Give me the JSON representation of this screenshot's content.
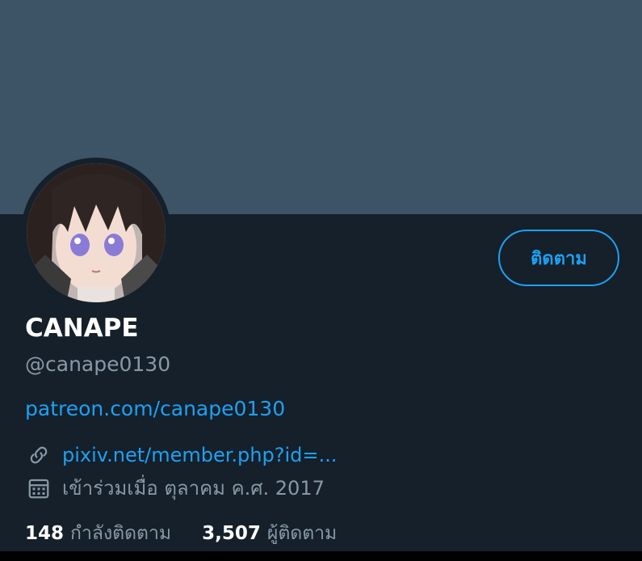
{
  "profile": {
    "display_name": "CANAPE",
    "handle": "@canape0130",
    "bio_link": "patreon.com/canape0130",
    "website": "pixiv.net/member.php?id=...",
    "joined": "เข้าร่วมเมื่อ ตุลาคม ค.ศ. 2017"
  },
  "actions": {
    "follow_label": "ติดตาม"
  },
  "stats": {
    "following_count": "148",
    "following_label": "กำลังติดตาม",
    "followers_count": "3,507",
    "followers_label": "ผู้ติดตาม"
  },
  "icons": {
    "link": "link-icon",
    "calendar": "calendar-icon"
  },
  "colors": {
    "background": "#15202b",
    "banner": "#3d5466",
    "accent": "#1da1f2",
    "secondary_text": "#8899a6",
    "primary_text": "#ffffff"
  }
}
